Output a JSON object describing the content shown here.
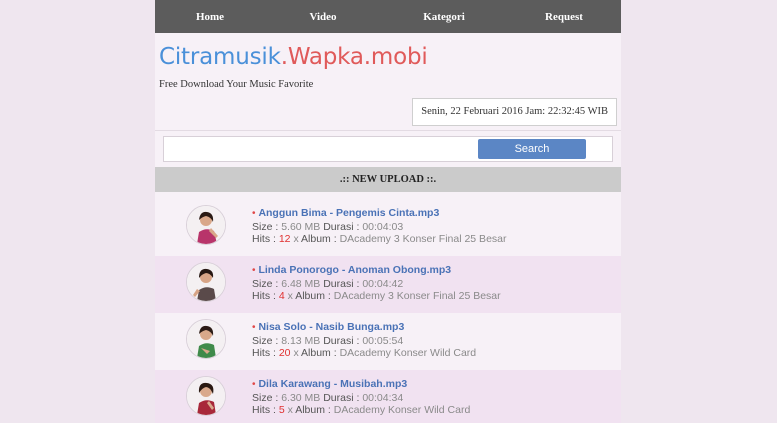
{
  "nav": [
    {
      "label": "Home"
    },
    {
      "label": "Video"
    },
    {
      "label": "Kategori"
    },
    {
      "label": "Request"
    }
  ],
  "site": {
    "title_part1": "Citramusik",
    "title_part2": ".Wapka.mobi",
    "tagline": "Free Download Your Music Favorite",
    "datetime": "Senin, 22 Februari 2016 Jam: 22:32:45 WIB"
  },
  "search": {
    "placeholder": "",
    "value": "",
    "button_label": "Search"
  },
  "section": {
    "header": ".:: NEW UPLOAD ::."
  },
  "labels": {
    "size": "Size :",
    "durasi": "Durasi :",
    "hits": "Hits :",
    "x": "x",
    "album": "Album :"
  },
  "songs": [
    {
      "title": "Anggun Bima - Pengemis Cinta.mp3",
      "size": "5.60 MB",
      "durasi": "00:04:03",
      "hits": "12",
      "album": "DAcademy 3 Konser Final 25 Besar"
    },
    {
      "title": "Linda Ponorogo - Anoman Obong.mp3",
      "size": "6.48 MB",
      "durasi": "00:04:42",
      "hits": "4",
      "album": "DAcademy 3 Konser Final 25 Besar"
    },
    {
      "title": "Nisa Solo - Nasib Bunga.mp3",
      "size": "8.13 MB",
      "durasi": "00:05:54",
      "hits": "20",
      "album": "DAcademy Konser Wild Card"
    },
    {
      "title": "Dila Karawang - Musibah.mp3",
      "size": "6.30 MB",
      "durasi": "00:04:34",
      "hits": "5",
      "album": "DAcademy Konser Wild Card"
    }
  ],
  "colors": {
    "nav_bg": "#5c5c5c",
    "title_blue": "#4a90d9",
    "title_red": "#e05a5a",
    "link_blue": "#4a72b6",
    "accent_red": "#e03030",
    "button_blue": "#5b86c5"
  }
}
